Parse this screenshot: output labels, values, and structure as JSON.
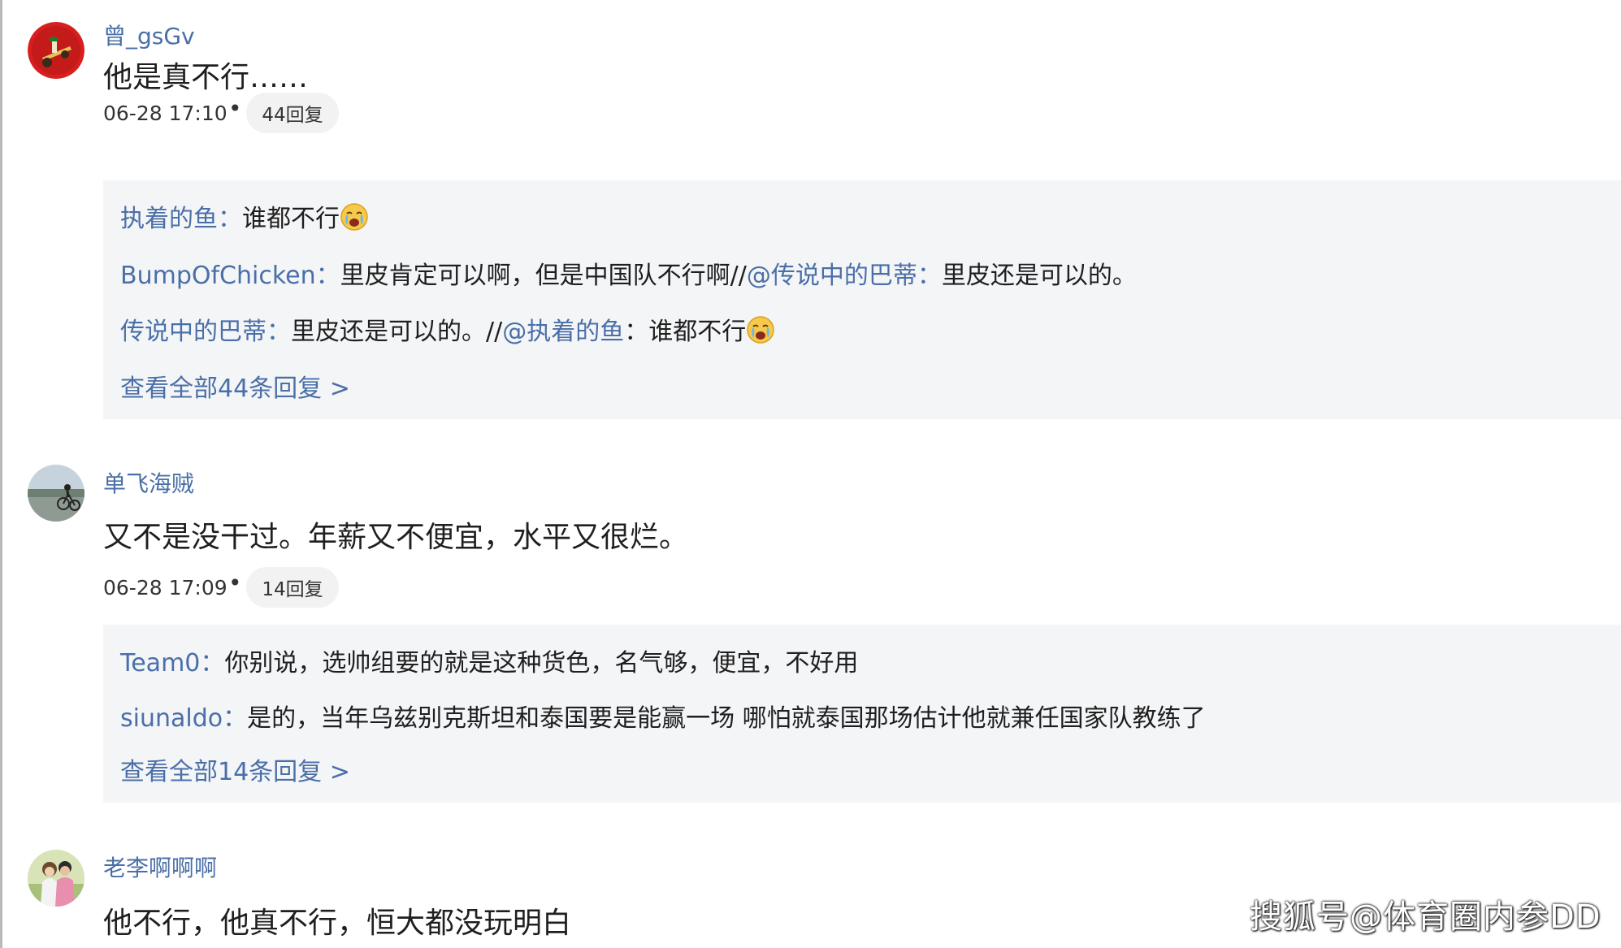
{
  "comments": [
    {
      "username": "曾_gsGv",
      "content": "他是真不行……",
      "time": "06-28 17:10",
      "dot": "•",
      "reply_count": "44回复",
      "replies": [
        {
          "name": "执着的鱼",
          "sep": "：",
          "text": "谁都不行",
          "emoji": "crying-emoji"
        },
        {
          "name": "BumpOfChicken",
          "sep": "：",
          "text": "里皮肯定可以啊，但是中国队不行啊//",
          "mention": "@传说中的巴蒂",
          "sep2": "：",
          "text2": "里皮还是可以的。"
        },
        {
          "name": "传说中的巴蒂",
          "sep": "：",
          "text": "里皮还是可以的。//",
          "mention": "@执着的鱼",
          "sep2": "：",
          "text2": "谁都不行",
          "emoji": "crying-emoji"
        }
      ],
      "view_all": "查看全部44条回复 >"
    },
    {
      "username": "单飞海贼",
      "content": "又不是没干过。年薪又不便宜，水平又很烂。",
      "time": "06-28 17:09",
      "dot": "•",
      "reply_count": "14回复",
      "replies": [
        {
          "name": "Team0",
          "sep": "：",
          "text": "你别说，选帅组要的就是这种货色，名气够，便宜，不好用"
        },
        {
          "name": "siunaldo",
          "sep": "：",
          "text": "是的，当年乌兹别克斯坦和泰国要是能赢一场 哪怕就泰国那场估计他就兼任国家队教练了"
        }
      ],
      "view_all": "查看全部14条回复 >"
    },
    {
      "username": "老李啊啊啊",
      "content": "他不行，他真不行，恒大都没玩明白"
    }
  ],
  "watermark": "搜狐号@体育圈内参DD",
  "colors": {
    "link": "#4a6fa8",
    "reply_bg": "#f4f5f7",
    "pill_bg": "#f2f2f3"
  }
}
